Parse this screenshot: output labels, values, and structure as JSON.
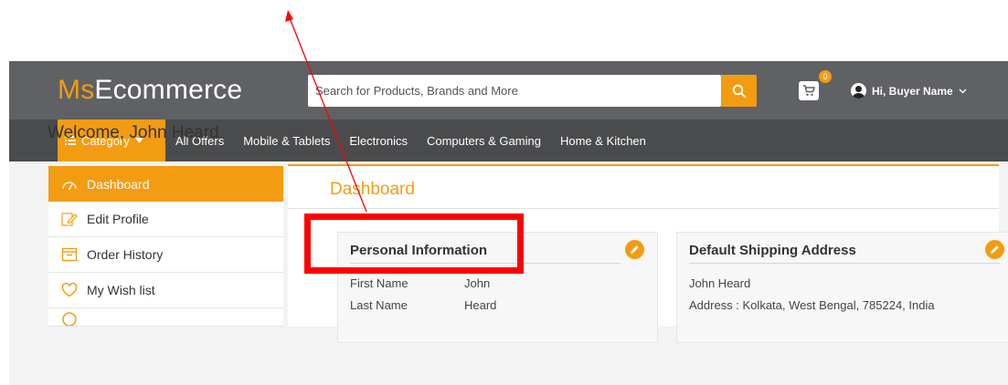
{
  "header": {
    "logo_ms": "Ms",
    "logo_rest": "Ecommerce",
    "search_placeholder": "Search for Products, Brands and More",
    "cart_count": "0",
    "user_greeting": "Hi, Buyer Name",
    "icons": {
      "search": "search-icon",
      "cart": "cart-icon",
      "avatar": "user-avatar-icon",
      "caret": "chevron-down-icon"
    }
  },
  "nav": {
    "category_label": "Category",
    "links": [
      "All Offers",
      "Mobile & Tablets",
      "Electronics",
      "Computers & Gaming",
      "Home & Kitchen"
    ]
  },
  "welcome": "Welcome, John Heard",
  "sidebar": {
    "items": [
      {
        "label": "Dashboard",
        "icon": "dashboard-icon",
        "active": true
      },
      {
        "label": "Edit Profile",
        "icon": "edit-profile-icon",
        "active": false
      },
      {
        "label": "Order History",
        "icon": "order-history-icon",
        "active": false
      },
      {
        "label": "My Wish list",
        "icon": "heart-icon",
        "active": false
      }
    ]
  },
  "main": {
    "title": "Dashboard",
    "personal": {
      "title": "Personal Information",
      "rows": [
        {
          "label": "First Name",
          "value": "John"
        },
        {
          "label": "Last Name",
          "value": "Heard"
        }
      ]
    },
    "shipping": {
      "title": "Default Shipping Address",
      "name": "John Heard",
      "address": "Address : Kolkata, West Bengal, 785224, India"
    }
  },
  "colors": {
    "accent": "#f39c12",
    "topbar": "#5f6164",
    "navbar": "#4a4b4d",
    "annotation": "#ff0000"
  }
}
